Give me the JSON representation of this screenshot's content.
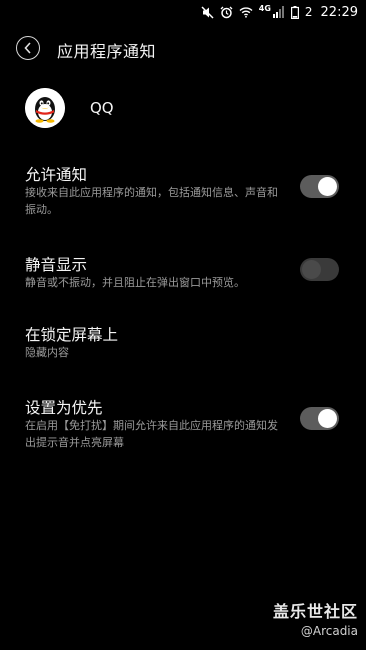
{
  "status_bar": {
    "network": "4G",
    "battery": "2",
    "time": "22:29"
  },
  "header": {
    "title": "应用程序通知"
  },
  "app": {
    "name": "QQ"
  },
  "settings": [
    {
      "title": "允许通知",
      "desc": "接收来自此应用程序的通知，包括通知信息、声音和振动。",
      "toggle": "on"
    },
    {
      "title": "静音显示",
      "desc": "静音或不振动，并且阻止在弹出窗口中预览。",
      "toggle": "off"
    },
    {
      "title": "在锁定屏幕上",
      "desc": "隐藏内容"
    },
    {
      "title": "设置为优先",
      "desc": "在启用【免打扰】期间允许来自此应用程序的通知发出提示音并点亮屏幕",
      "toggle": "on"
    }
  ],
  "watermark": {
    "line1": "盖乐世社区",
    "line2": "@Arcadia"
  }
}
